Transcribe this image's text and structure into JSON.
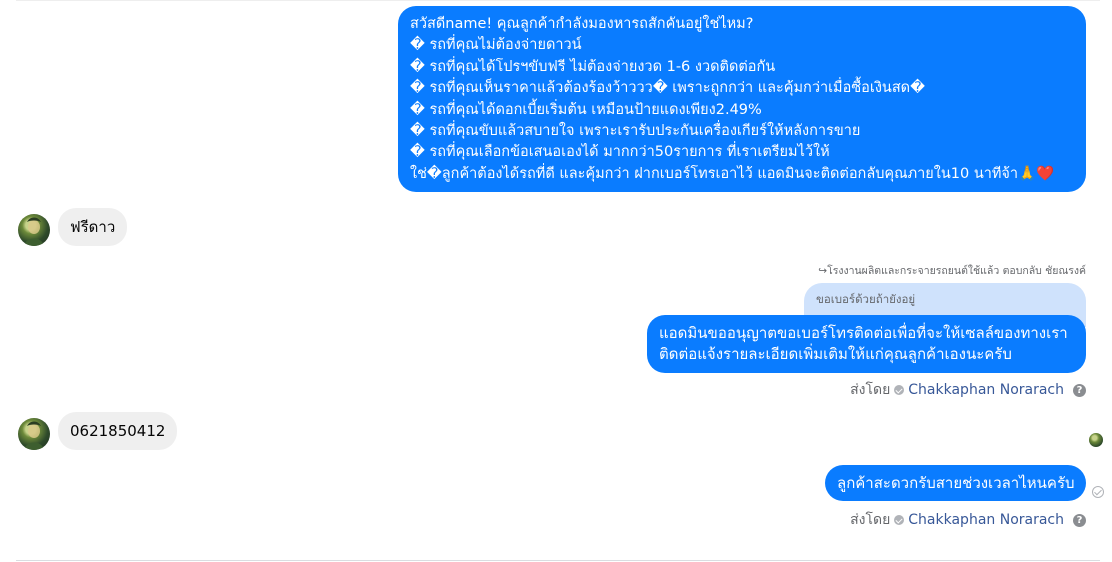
{
  "messages": {
    "promo": {
      "lines": [
        "สวัสดีname! คุณลูกค้ากำลังมองหารถสักคันอยู่ใช่ไหม?",
        "� รถที่คุณไม่ต้องจ่ายดาวน์",
        "� รถที่คุณได้โปรฯขับฟรี ไม่ต้องจ่ายงวด 1-6 งวดติดต่อกัน",
        "� รถที่คุณเห็นราคาแล้วต้องร้องว้าววว� เพราะถูกกว่า และคุ้มกว่าเมื่อซื้อเงินสด�",
        "� รถที่คุณได้ดอกเบี้ยเริ่มต้น เหมือนป้ายแดงเพียง2.49%",
        "� รถที่คุณขับแล้วสบายใจ เพราะเรารับประกันเครื่องเกียร์ให้หลังการขาย",
        "� รถที่คุณเลือกข้อเสนอเองได้ มากกว่า50รายการ ที่เราเตรียมไว้ให้",
        "ใช่�ลูกค้าต้องได้รถที่ดี และคุ้มกว่า ฝากเบอร์โทรเอาไว้ แอดมินจะติดต่อกลับคุณภายใน10 นาทีจ้า🙏❤️"
      ]
    },
    "incoming_1": "ฟรีดาว",
    "reply_meta": "↪︎โรงงานผลิตและกระจายรถยนต์ใช้แล้ว ตอบกลับ ชัยณรงค์",
    "reply_quote": "ขอเบอร์ด้วยถ้ายังอยู่",
    "admin_reply": {
      "line1": "แอดมินขออนุญาตขอเบอร์โทรติดต่อเพื่อที่จะให้เซลล์ของทางเรา",
      "line2": "ติดต่อแจ้งรายละเอียดเพิ่มเติมให้แก่คุณลูกค้าเองนะครับ"
    },
    "incoming_2": "0621850412",
    "admin_followup": "ลูกค้าสะดวกรับสายช่วงเวลาไหนครับ"
  },
  "sent_by": {
    "prefix": "ส่งโดย",
    "name": "Chakkaphan Norarach",
    "help": "?"
  },
  "colors": {
    "outgoing_bubble": "#0a7cff",
    "incoming_bubble": "#efefef",
    "reply_quote_bg": "#cfe2fc"
  }
}
